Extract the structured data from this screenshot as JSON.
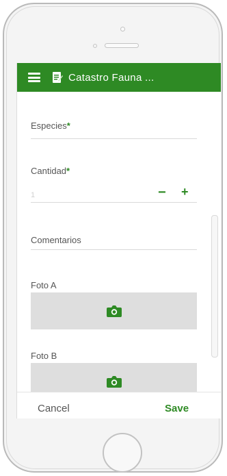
{
  "app_bar": {
    "title": "Catastro Fauna ...",
    "menu_icon": "hamburger-menu-icon",
    "doc_icon": "edit-document-icon",
    "color": "#2e8a24"
  },
  "form": {
    "especies": {
      "label": "Especies",
      "required_mark": "*"
    },
    "cantidad": {
      "label": "Cantidad",
      "required_mark": "*",
      "value": "1",
      "minus_label": "−",
      "plus_label": "+"
    },
    "comentarios": {
      "label": "Comentarios"
    },
    "foto_a": {
      "label": "Foto A",
      "icon": "camera-icon"
    },
    "foto_b": {
      "label": "Foto B",
      "icon": "camera-icon"
    }
  },
  "footer": {
    "cancel_label": "Cancel",
    "save_label": "Save"
  }
}
